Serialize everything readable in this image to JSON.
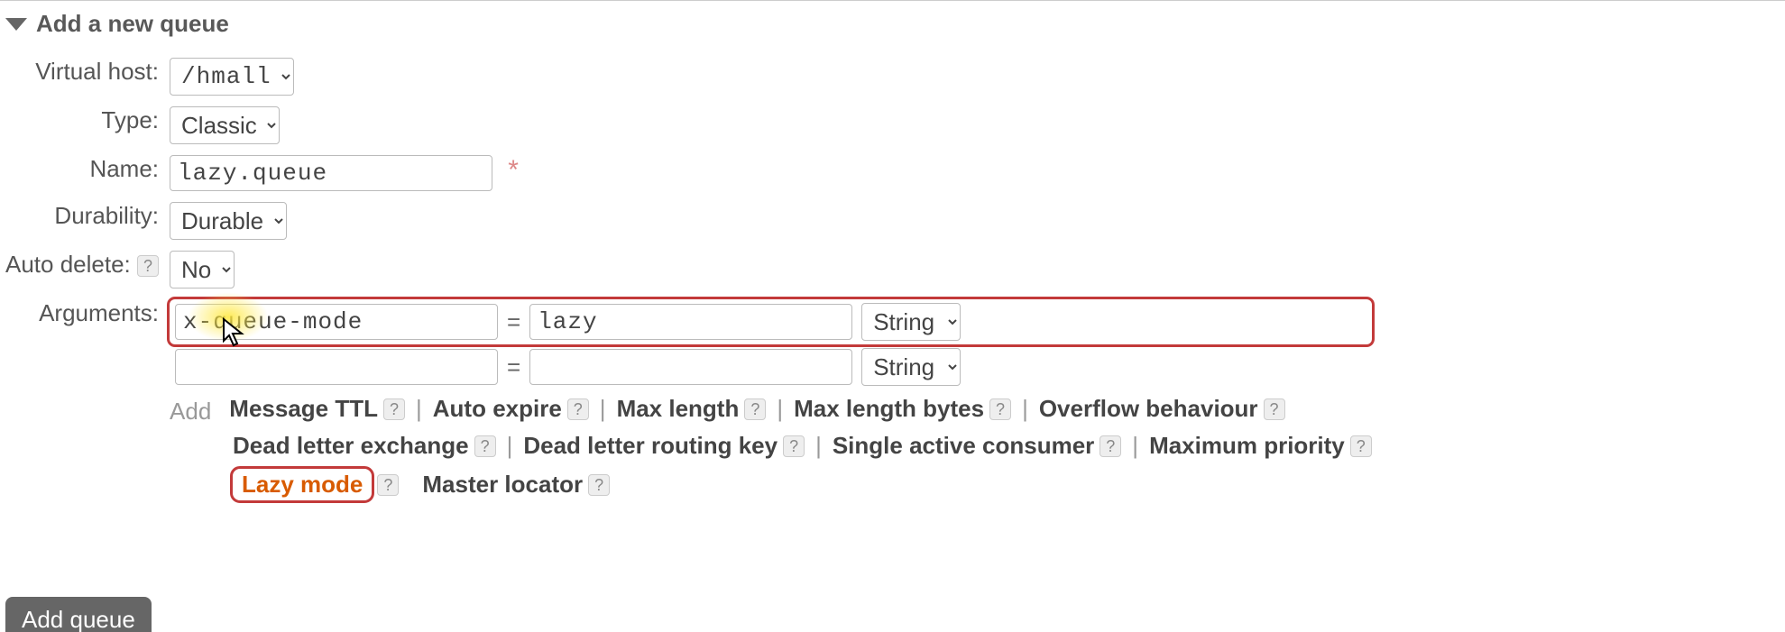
{
  "section": {
    "title": "Add a new queue"
  },
  "labels": {
    "vhost": "Virtual host:",
    "type": "Type:",
    "name": "Name:",
    "durability": "Durability:",
    "autodelete": "Auto delete:",
    "arguments": "Arguments:"
  },
  "values": {
    "vhost": "/hmall",
    "type": "Classic",
    "name": "lazy.queue",
    "durability": "Durable",
    "autodelete": "No"
  },
  "args": {
    "row1": {
      "key": "x-queue-mode",
      "val": "lazy",
      "type": "String"
    },
    "row2": {
      "key": "",
      "val": "",
      "type": "String"
    }
  },
  "add_label": "Add",
  "shortcuts": {
    "message_ttl": "Message TTL",
    "auto_expire": "Auto expire",
    "max_length": "Max length",
    "max_length_bytes": "Max length bytes",
    "overflow": "Overflow behaviour",
    "dlx": "Dead letter exchange",
    "dlrk": "Dead letter routing key",
    "sac": "Single active consumer",
    "max_prio": "Maximum priority",
    "lazy": "Lazy mode",
    "master": "Master locator"
  },
  "help_glyph": "?",
  "divider": "|",
  "mandatory": "*",
  "eq": "=",
  "button": "Add queue"
}
